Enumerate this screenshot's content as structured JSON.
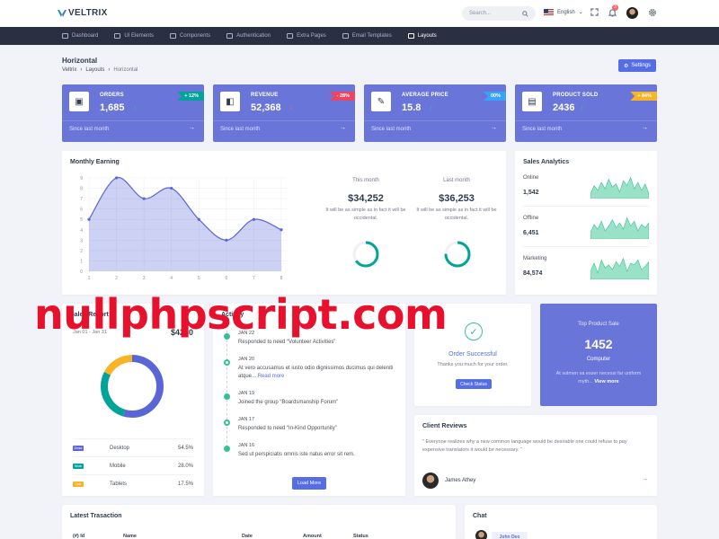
{
  "header": {
    "brand": "VELTRIX",
    "search_placeholder": "Search...",
    "language": "English",
    "notification_count": "3"
  },
  "nav": [
    {
      "label": "Dashboard",
      "icon": "home-icon"
    },
    {
      "label": "UI Elements",
      "icon": "tools-icon"
    },
    {
      "label": "Components",
      "icon": "layers-icon"
    },
    {
      "label": "Authentication",
      "icon": "lock-icon"
    },
    {
      "label": "Extra Pages",
      "icon": "file-icon"
    },
    {
      "label": "Email Templates",
      "icon": "mail-icon"
    },
    {
      "label": "Layouts",
      "icon": "layout-icon"
    }
  ],
  "page": {
    "title": "Horizontal",
    "breadcrumb": [
      "Veltrix",
      "Layouts",
      "Horizontal"
    ],
    "settings_label": "Settings"
  },
  "stats": [
    {
      "label": "ORDERS",
      "value": "1,685",
      "badge": "+ 12%",
      "badge_color": "#02a499",
      "trend": "up",
      "since": "Since last month",
      "icon": "cube-icon"
    },
    {
      "label": "REVENUE",
      "value": "52,368",
      "badge": "- 28%",
      "badge_color": "#ec4561",
      "trend": "down",
      "since": "Since last month",
      "icon": "buffer-icon"
    },
    {
      "label": "AVERAGE PRICE",
      "value": "15.8",
      "badge": "00%",
      "badge_color": "#38a4f8",
      "trend": "up",
      "since": "Since last month",
      "icon": "tag-icon"
    },
    {
      "label": "PRODUCT SOLD",
      "value": "2436",
      "badge": "+ 84%",
      "badge_color": "#f8b425",
      "trend": "up",
      "since": "Since last month",
      "icon": "briefcase-icon"
    }
  ],
  "earning": {
    "title": "Monthly Earning",
    "this_month": {
      "label": "This month",
      "value": "$34,252",
      "desc": "It will be as simple as in fact it will be occidental.",
      "progress": 0.65
    },
    "last_month": {
      "label": "Last month",
      "value": "$36,253",
      "desc": "It will be as simple as in fact it will be occidental.",
      "progress": 0.75
    }
  },
  "chart_data": {
    "type": "area",
    "x": [
      1,
      2,
      3,
      4,
      5,
      6,
      7,
      8
    ],
    "values": [
      5,
      9,
      7,
      8,
      5,
      3,
      5,
      4
    ],
    "ylim": [
      0,
      9
    ],
    "xlim": [
      1,
      8
    ],
    "x_ticks": [
      "1",
      "2",
      "3",
      "4",
      "5",
      "6",
      "7",
      "8"
    ],
    "y_ticks": [
      "0",
      "1",
      "2",
      "3",
      "4",
      "5",
      "6",
      "7",
      "8",
      "9"
    ],
    "grid": true,
    "color": "#5b66d6"
  },
  "analytics": {
    "title": "Sales Analytics",
    "rows": [
      {
        "name": "Online",
        "value": "1,542"
      },
      {
        "name": "Offline",
        "value": "6,451"
      },
      {
        "name": "Marketing",
        "value": "84,574"
      }
    ],
    "color": "#34c38f"
  },
  "sales_report": {
    "title": "Sales Report",
    "period": "Jan 01 - Jan 31",
    "amount": "$4230",
    "donut": [
      0.545,
      0.28,
      0.175
    ],
    "legend": [
      {
        "tag": "Desk",
        "name": "Desktop",
        "pct": "54.5%",
        "color": "#5b66d6"
      },
      {
        "tag": "Mob",
        "name": "Mobile",
        "pct": "28.0%",
        "color": "#02a499"
      },
      {
        "tag": "Tab",
        "name": "Tablets",
        "pct": "17.5%",
        "color": "#f8b425"
      }
    ]
  },
  "activity": {
    "title": "Activity",
    "items": [
      {
        "date": "JAN 22",
        "text": "Responded to need “Volunteer Activities”",
        "more": ""
      },
      {
        "date": "JAN 20",
        "text": "At vero accusamus et iusto odio dignissimos ducimus qui deleniti atque...",
        "more": "Read more"
      },
      {
        "date": "JAN 19",
        "text": "Joined the group “Boardsmanship Forum”",
        "more": ""
      },
      {
        "date": "JAN 17",
        "text": "Responded to need “In-Kind Opportunity”",
        "more": ""
      },
      {
        "date": "JAN 16",
        "text": "Sed ut perspiciatis omnis iste natus error sit rem.",
        "more": ""
      }
    ],
    "load_more": "Load More"
  },
  "order": {
    "title": "Order Successful",
    "subtitle": "Thanks you much for your order.",
    "button": "Check Status"
  },
  "top_product": {
    "heading": "Top Product Sale",
    "value": "1452",
    "name": "Computer",
    "desc": "At solmen va esser necessi far uniform myth...",
    "more": "View more"
  },
  "reviews": {
    "title": "Client Reviews",
    "quote": "\" Everyone realizes why a new common language would be desirable one could refuse to pay expensive translators it would be necessary. \"",
    "author": "James Athey"
  },
  "transactions": {
    "title": "Latest Trasaction",
    "columns": [
      "(#) Id",
      "Name",
      "Date",
      "Amount",
      "Status"
    ]
  },
  "chat": {
    "title": "Chat",
    "first_name": "John Deo"
  },
  "watermark": "nullphpscript.com"
}
